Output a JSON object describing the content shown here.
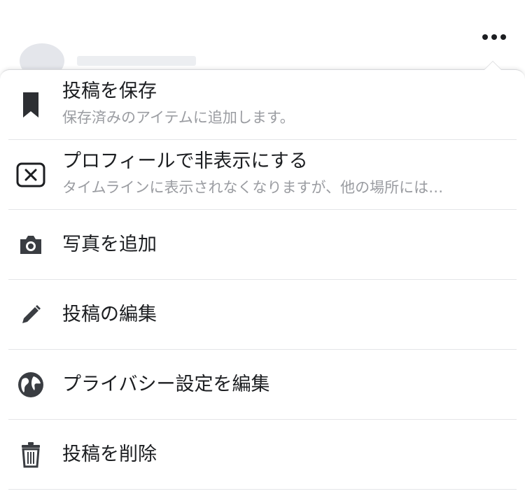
{
  "menu": {
    "items": [
      {
        "icon": "bookmark-icon",
        "label": "投稿を保存",
        "sub": "保存済みのアイテムに追加します。"
      },
      {
        "icon": "close-box-icon",
        "label": "プロフィールで非表示にする",
        "sub": "タイムラインに表示されなくなりますが、他の場所には…"
      },
      {
        "icon": "camera-icon",
        "label": "写真を追加"
      },
      {
        "icon": "pencil-icon",
        "label": "投稿の編集"
      },
      {
        "icon": "globe-icon",
        "label": "プライバシー設定を編集"
      },
      {
        "icon": "trash-icon",
        "label": "投稿を削除"
      }
    ]
  },
  "colors": {
    "icon": "#2d2f33",
    "secondary_text": "#9a9ca1",
    "divider": "#e4e5e8"
  }
}
